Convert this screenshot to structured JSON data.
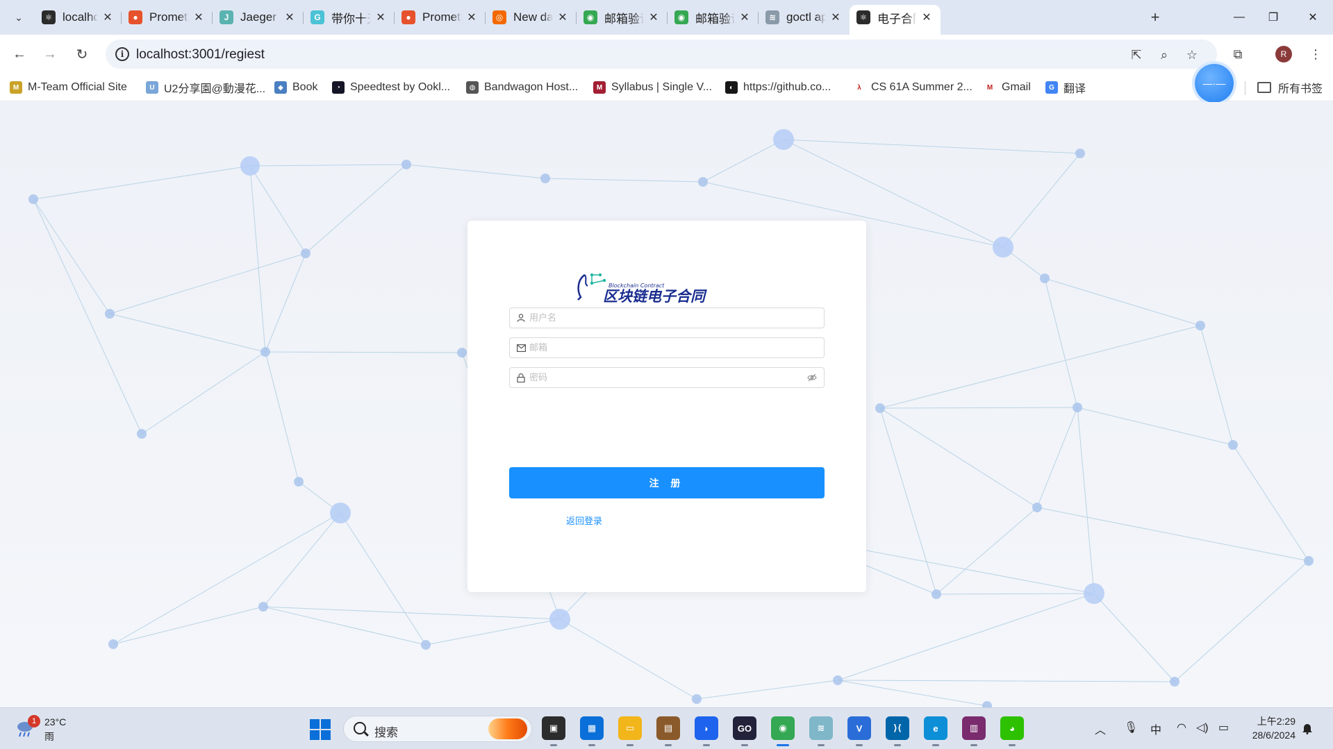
{
  "browser": {
    "tabs": [
      {
        "title": "localhost",
        "icon": "react-icon",
        "color": "#2b2b2b",
        "glyph": "⚛"
      },
      {
        "title": "Promethe",
        "icon": "prometheus-icon",
        "color": "#e6522c",
        "glyph": "●"
      },
      {
        "title": "Jaeger UI",
        "icon": "jaeger-icon",
        "color": "#5ab3b0",
        "glyph": "J"
      },
      {
        "title": "带你十天轻",
        "icon": "gopher-icon",
        "color": "#4bc2d6",
        "glyph": "G"
      },
      {
        "title": "Promethe",
        "icon": "prometheus-icon",
        "color": "#e6522c",
        "glyph": "●"
      },
      {
        "title": "New dash",
        "icon": "grafana-icon",
        "color": "#f46800",
        "glyph": "◎"
      },
      {
        "title": "邮箱验证码",
        "icon": "chrome-icon",
        "color": "#34a853",
        "glyph": "◉"
      },
      {
        "title": "邮箱验证码",
        "icon": "chrome-icon",
        "color": "#34a853",
        "glyph": "◉"
      },
      {
        "title": "goctl api",
        "icon": "gozero-icon",
        "color": "#8a9aa8",
        "glyph": "≋"
      },
      {
        "title": "电子合同系",
        "icon": "react-icon",
        "color": "#2b2b2b",
        "glyph": "⚛",
        "active": true
      }
    ],
    "url": "localhost:3001/regiest",
    "profile_initial": "R",
    "bookmarks": [
      {
        "label": "M-Team Official Site",
        "icon": "mteam-icon",
        "color": "#c9a227",
        "glyph": "M"
      },
      {
        "label": "U2分享園@動漫花...",
        "icon": "u2-icon",
        "color": "#7aa6d8",
        "glyph": "U"
      },
      {
        "label": "Book",
        "icon": "book-icon",
        "color": "#4a7fc1",
        "glyph": "◆"
      },
      {
        "label": "Speedtest by Ookl...",
        "icon": "speedtest-icon",
        "color": "#141526",
        "glyph": "◔"
      },
      {
        "label": "Bandwagon Host...",
        "icon": "globe-icon",
        "color": "#555555",
        "glyph": "◍"
      },
      {
        "label": "Syllabus | Single V...",
        "icon": "mit-icon",
        "color": "#a31f34",
        "glyph": "M"
      },
      {
        "label": "https://github.co...",
        "icon": "github-icon",
        "color": "#181717",
        "glyph": "◐"
      },
      {
        "label": "CS 61A Summer 2...",
        "icon": "lambda-icon",
        "color": "#ffffff",
        "glyph": "λ"
      },
      {
        "label": "Gmail",
        "icon": "gmail-icon",
        "color": "#ffffff",
        "glyph": "M"
      },
      {
        "label": "翻译",
        "icon": "translate-icon",
        "color": "#4285f4",
        "glyph": "G"
      }
    ],
    "bookmarks_folder": "所有书签"
  },
  "page": {
    "logo": {
      "subtitle": "Blockchain Contract",
      "title": "区块链电子合同"
    },
    "form": {
      "username_placeholder": "用户名",
      "email_placeholder": "邮箱",
      "password_placeholder": "密码",
      "submit_label": "注 册",
      "back_link": "返回登录"
    },
    "colors": {
      "primary": "#1890ff",
      "logo_blue": "#1a2d8f",
      "logo_teal": "#1fb6a0"
    }
  },
  "taskbar": {
    "weather": {
      "temp": "23°C",
      "desc": "雨",
      "badge": "1"
    },
    "search_label": "搜索",
    "apps": [
      {
        "name": "task-view-icon",
        "color": "#2c2c2c",
        "glyph": "▣"
      },
      {
        "name": "store-icon",
        "color": "#0a6fd8",
        "glyph": "▦"
      },
      {
        "name": "file-explorer-icon",
        "color": "#f2b51a",
        "glyph": "▭"
      },
      {
        "name": "package-icon",
        "color": "#8b5a2b",
        "glyph": "▤"
      },
      {
        "name": "docker-icon",
        "color": "#1d63ed",
        "glyph": "◗"
      },
      {
        "name": "goland-icon",
        "color": "#22223b",
        "glyph": "GO"
      },
      {
        "name": "chrome-icon",
        "color": "#34a853",
        "glyph": "◉",
        "active": true
      },
      {
        "name": "gozero-icon",
        "color": "#7fb7c9",
        "glyph": "≋"
      },
      {
        "name": "vim-icon",
        "color": "#2a6dd8",
        "glyph": "V"
      },
      {
        "name": "vscode-icon",
        "color": "#0065a9",
        "glyph": "⟩⟨"
      },
      {
        "name": "edge-icon",
        "color": "#0c8fd6",
        "glyph": "e"
      },
      {
        "name": "winrar-icon",
        "color": "#7a2b6e",
        "glyph": "▥"
      },
      {
        "name": "wechat-icon",
        "color": "#2dc100",
        "glyph": "◕"
      }
    ],
    "ime": "中",
    "time": "上午2:29",
    "date": "28/6/2024"
  }
}
